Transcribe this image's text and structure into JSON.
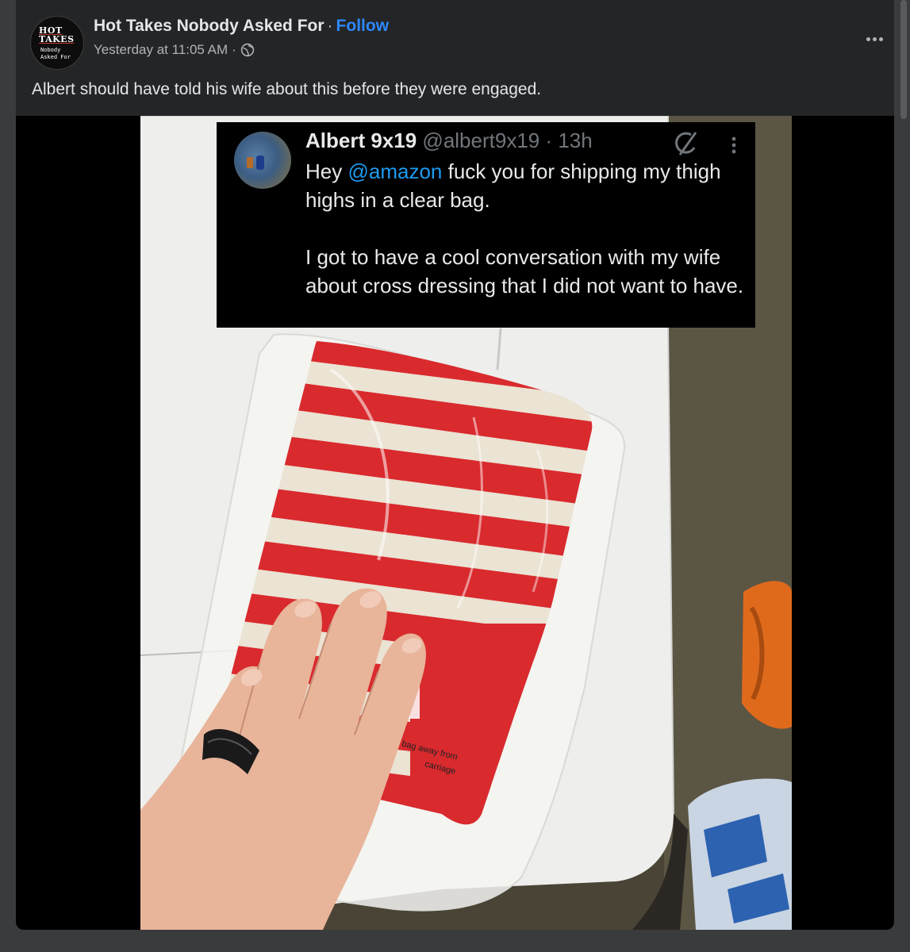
{
  "post": {
    "page_name": "Hot Takes Nobody Asked For",
    "separator": "·",
    "follow_label": "Follow",
    "timestamp": "Yesterday at 11:05 AM",
    "meta_separator": "·",
    "privacy_icon": "globe-icon",
    "more_icon": "more-options-icon",
    "text": "Albert should have told his wife about this before they were engaged.",
    "avatar": {
      "line1": "HOT",
      "line2": "TAKES",
      "line3": "Nobody",
      "line4": "Asked For"
    }
  },
  "photo": {
    "tweet": {
      "name": "Albert 9x19",
      "handle": "@albert9x19 · 13h",
      "body_prefix": "Hey ",
      "mention": "@amazon",
      "body_rest": " fuck you for shipping my thigh highs in a clear bag.",
      "body_second": "I got to have a cool conversation with my wife about cross dressing that I did not want to have.",
      "grok_icon": "grok-icon",
      "more_icon": "vertical-more-icon"
    },
    "package_label_lines": [
      "astic bag away from",
      "dren",
      "carriage"
    ]
  },
  "colors": {
    "card_bg": "#242526",
    "text_primary": "#e4e6eb",
    "text_secondary": "#b0b3b8",
    "link_blue": "#2d88ff",
    "twitter_blue": "#1d9bf0",
    "stripe_red": "#d92a2e",
    "stripe_cream": "#ebe3d3"
  }
}
